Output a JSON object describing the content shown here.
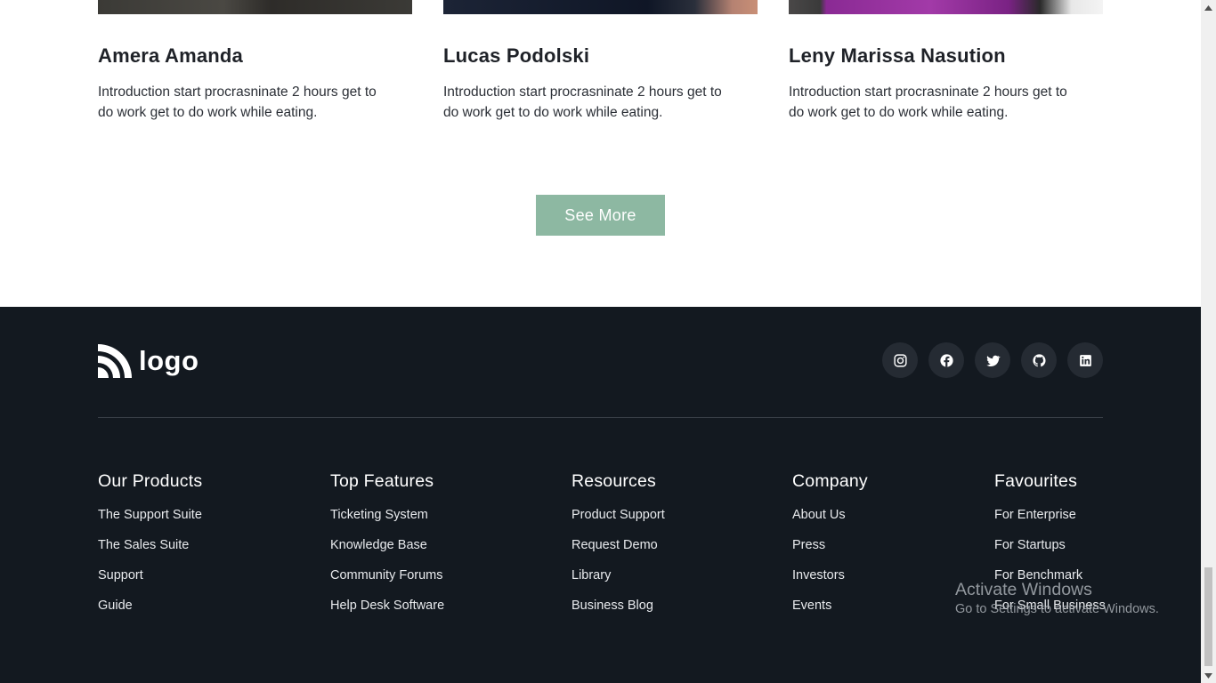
{
  "team_cards": [
    {
      "name": "Amera Amanda",
      "description": "Introduction start procrasninate 2 hours get to do work get to do work while eating.",
      "photo_color": "#3b3a36"
    },
    {
      "name": "Lucas Podolski",
      "description": "Introduction start procrasninate 2 hours get to do work get to do work while eating.",
      "photo_color": "#1c2436"
    },
    {
      "name": "Leny Marissa Nasution",
      "description": "Introduction start procrasninate 2 hours get to do work get to do work while eating.",
      "photo_color": "#8a2a94"
    }
  ],
  "see_more_label": "See More",
  "footer": {
    "logo_text": "logo",
    "social": [
      "instagram-icon",
      "facebook-icon",
      "twitter-icon",
      "github-icon",
      "linkedin-icon"
    ],
    "columns": [
      {
        "title": "Our Products",
        "items": [
          "The Support Suite",
          "The Sales Suite",
          "Support",
          "Guide"
        ]
      },
      {
        "title": "Top Features",
        "items": [
          "Ticketing System",
          "Knowledge Base",
          "Community Forums",
          "Help Desk Software"
        ]
      },
      {
        "title": "Resources",
        "items": [
          "Product Support",
          "Request Demo",
          "Library",
          "Business Blog"
        ]
      },
      {
        "title": "Company",
        "items": [
          "About Us",
          "Press",
          "Investors",
          "Events"
        ]
      },
      {
        "title": "Favourites",
        "items": [
          "For Enterprise",
          "For Startups",
          "For Benchmark",
          "For Small Business"
        ]
      }
    ]
  },
  "watermark": {
    "title": "Activate Windows",
    "subtitle": "Go to Settings to activate Windows."
  },
  "colors": {
    "accent": "#8db8a2",
    "footer_bg": "#131920",
    "social_bg": "#252b33"
  }
}
